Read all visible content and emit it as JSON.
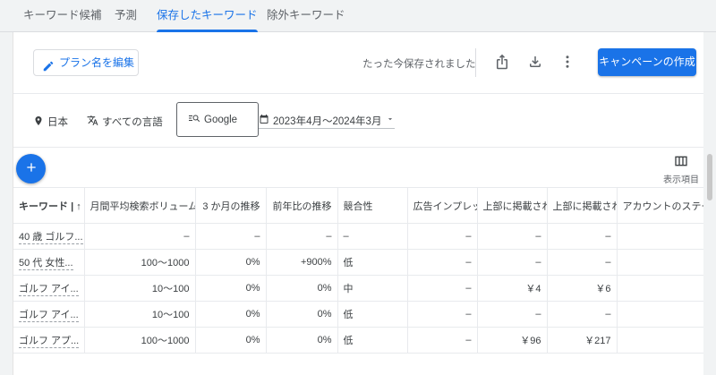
{
  "tabs": [
    {
      "label": "キーワード候補"
    },
    {
      "label": "予測"
    },
    {
      "label": "保存したキーワード"
    },
    {
      "label": "除外キーワード"
    }
  ],
  "toolbar": {
    "edit_plan_label": "プラン名を編集",
    "saved_status": "たった今保存されました",
    "create_campaign_label": "キャンペーンの作成"
  },
  "filters": {
    "location": "日本",
    "language": "すべての言語",
    "network": "Google",
    "date_range": "2023年4月～2024年3月"
  },
  "columns_button_label": "表示項目",
  "table": {
    "headers": [
      "キーワード",
      "月間平均検索ボリューム",
      "3 か月の推移",
      "前年比の推移",
      "競合性",
      "広告インプレッ",
      "上部に掲載され",
      "上部に掲載され",
      "アカウントのステー"
    ],
    "rows": [
      [
        "40 歳 ゴルフ...",
        "–",
        "–",
        "–",
        "–",
        "–",
        "–",
        "–",
        ""
      ],
      [
        "50 代 女性...",
        "100～1000",
        "0%",
        "+900%",
        "低",
        "–",
        "–",
        "–",
        ""
      ],
      [
        "ゴルフ アイ...",
        "10～100",
        "0%",
        "0%",
        "中",
        "–",
        "￥4",
        "￥6",
        ""
      ],
      [
        "ゴルフ アイ...",
        "10～100",
        "0%",
        "0%",
        "低",
        "–",
        "–",
        "–",
        ""
      ],
      [
        "ゴルフ アプ...",
        "100～1000",
        "0%",
        "0%",
        "低",
        "–",
        "￥96",
        "￥217",
        ""
      ]
    ]
  },
  "colors": {
    "accent": "#1a73e8"
  }
}
